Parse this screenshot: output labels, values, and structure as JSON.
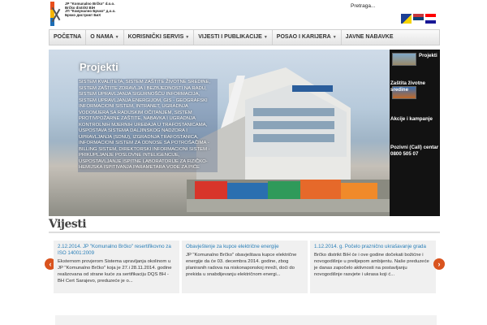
{
  "header": {
    "logo_text": "JP \"Komunalno Brčko\" d.o.o.\nBrčko distrikt BiH\nЈП \"Комунално Брчко\" д.о.о.\nБрчко дистрикт БиХ",
    "search_label": "Pretraga...",
    "flags": [
      "bs",
      "sr",
      "hr"
    ]
  },
  "nav": {
    "items": [
      {
        "label": "POČETNA",
        "dropdown": false
      },
      {
        "label": "O NAMA",
        "dropdown": true
      },
      {
        "label": "KORISNIČKI SERVIS",
        "dropdown": true
      },
      {
        "label": "VIJESTI I PUBLIKACIJE",
        "dropdown": true
      },
      {
        "label": "POSAO I KARIJERA",
        "dropdown": true
      },
      {
        "label": "JAVNE NABAVKE",
        "dropdown": false
      }
    ],
    "caret": "▼"
  },
  "slider": {
    "title": "Projekti",
    "text": "Sistem kvaliteta, sistem zaštite životne sredine, sistem zaštite zdravlja i bezbjednosti na radu, sistem upravljanja sigurnošću informacija, sistem upravljanja energijom, GIS - Geografski informacioni sistem, intranet, ugradnja vodomjera sa radijskim očitanjem, sistem protivpožarne zaštite, nabavka i ugradnja kontrolnih mjernih uređaja u trafostanicama, uspostava sistema daljinskog nadzora i upravljanja (SDNU), izgradnja trafostanica, informacioni sistem za odnose sa potrošačima - billing sistem, direktorski informacioni sistem - prikupljanje poslovne inteligencije, uspostavljanje ispitne laboratorije za fizičko-hemijska ispitivanja parametara vode za piće"
  },
  "thumbs": [
    {
      "label": "Projekti"
    },
    {
      "label": ""
    },
    {
      "label": "Zaštita životne sredine"
    },
    {
      "label": "Akcije i kampanje"
    },
    {
      "label": "Pozivni (Call) centar 0800 505 07"
    }
  ],
  "news": {
    "heading": "Vijesti",
    "prev_icon": "‹",
    "next_icon": "›",
    "items": [
      {
        "title": "2.12.2014. JP \"Komunalno Brčko\" resertifikovno za ISO 14001:2009",
        "body": "Eksternom provjerom Sistema upravljanja okolinom u JP \"Komunalno Brčko\" koja je 27.i 28.11.2014. godine realizovana od strane kuće za sertifikaciju DQS BH - BH Cert Sarajevo, preduzeće je o..."
      },
      {
        "title": "Obavještenje za kupce električne energije",
        "body": "JP \"Komunalno Brčko\" obavještava kupce električne energije da će 03. decembra 2014. godine, zbog planiranih radova na niskonaponskoj mreži, doći do prekida u snabdijevanju električnom energi..."
      },
      {
        "title": "1.12.2014. g. Počelo praznično ukrašavanje grada",
        "body": "Brčko distrikt BiH će i ove godine dočekati božićne i novogodišnje u prelijepom ambijentu. Naše preduzeće je danas započelo aktivnosti na postavljanju novogodišnje rasvjete i ukrasa koji ć..."
      }
    ]
  }
}
